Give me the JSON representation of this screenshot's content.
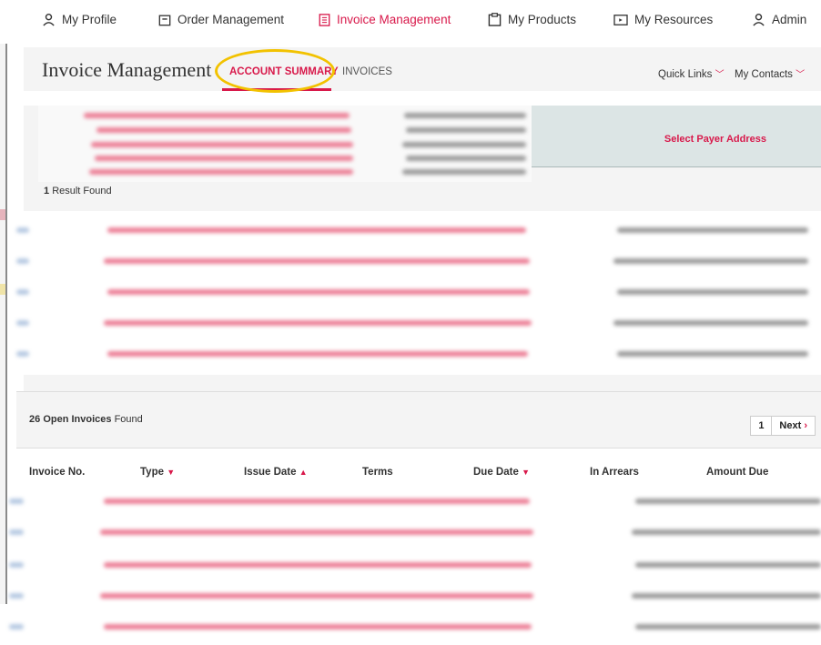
{
  "nav": {
    "items": [
      {
        "label": "My Profile",
        "icon": "user-icon"
      },
      {
        "label": "Order Management",
        "icon": "calendar-icon"
      },
      {
        "label": "Invoice Management",
        "icon": "document-icon",
        "active": true
      },
      {
        "label": "My Products",
        "icon": "clipboard-icon"
      },
      {
        "label": "My Resources",
        "icon": "play-box-icon"
      },
      {
        "label": "Admin",
        "icon": "user-icon"
      }
    ],
    "active_color": "#d8184a"
  },
  "header": {
    "title": "Invoice Management",
    "tabs": [
      {
        "label": "ACCOUNT SUMMARY",
        "active": true
      },
      {
        "label": "INVOICES",
        "active": false
      }
    ],
    "quick_links": "Quick Links",
    "my_contacts": "My Contacts"
  },
  "payer": {
    "select_label": "Select Payer Address",
    "result_count": "1",
    "result_label": "Result Found"
  },
  "invoices": {
    "count": "26",
    "count_label": "Open Invoices",
    "found_label": "Found",
    "page": "1",
    "next_label": "Next",
    "columns": [
      {
        "label": "Invoice No.",
        "sort": ""
      },
      {
        "label": "Type",
        "sort": "down"
      },
      {
        "label": "Issue Date",
        "sort": "up"
      },
      {
        "label": "Terms",
        "sort": ""
      },
      {
        "label": "Due Date",
        "sort": "down"
      },
      {
        "label": "In Arrears",
        "sort": ""
      },
      {
        "label": "Amount Due",
        "sort": ""
      }
    ]
  },
  "colors": {
    "accent": "#d8184a",
    "highlight": "#f2c200",
    "panel": "#f4f4f4",
    "payer_band": "#dce5e5"
  }
}
